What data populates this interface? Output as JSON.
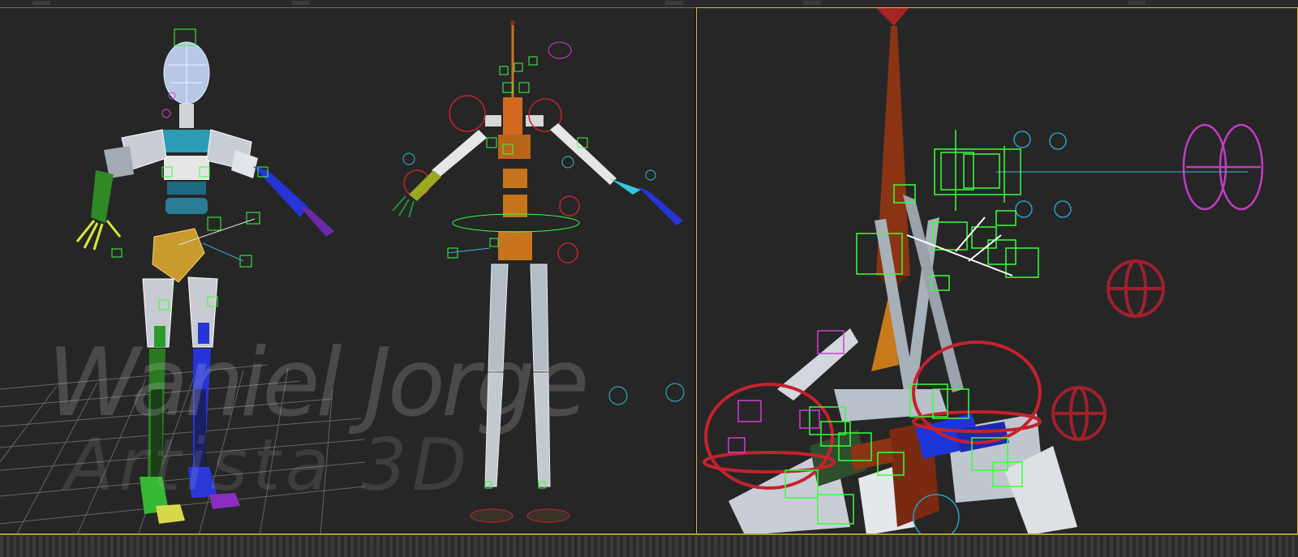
{
  "app": {
    "name": "3D character rig viewports"
  },
  "watermark": {
    "line1": "Waniel Jorge",
    "line2": "Artista 3D"
  },
  "viewports": [
    {
      "id": "left",
      "content": "two biped rigs in T-pose (perspective + front)"
    },
    {
      "id": "right",
      "content": "zoomed rig close-up, active viewport"
    }
  ],
  "colors": {
    "viewport_bg": "#262626",
    "active_border": "#d8b24a",
    "grid": "#6f6f6f",
    "control_green": "#39ff3c",
    "control_red": "#c4222e",
    "control_magenta": "#d23cd2",
    "control_cyan": "#38b5d6",
    "bone_gray": "#a8b0ba",
    "bone_blue": "#2634d8",
    "bone_orange": "#c8741c",
    "bone_brown": "#8a3414"
  },
  "icons": [
    "grid-floor-icon",
    "character-rig-icon",
    "helper-control-icon"
  ]
}
